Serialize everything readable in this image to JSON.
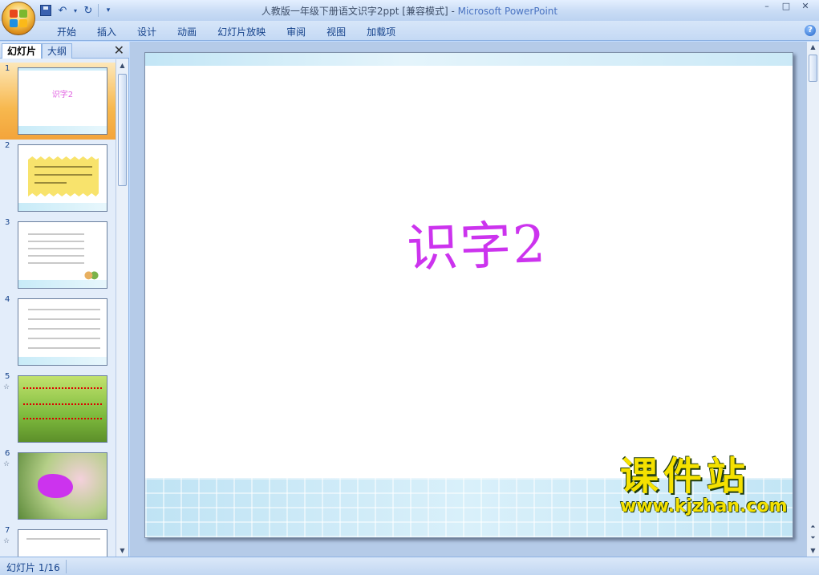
{
  "window": {
    "title_doc": "人教版一年级下册语文识字2ppt [兼容模式]",
    "title_sep": " - ",
    "title_app": "Microsoft PowerPoint",
    "controls": [
      "–",
      "□",
      "✕"
    ]
  },
  "ribbon": {
    "tabs": [
      "开始",
      "插入",
      "设计",
      "动画",
      "幻灯片放映",
      "审阅",
      "视图",
      "加载项"
    ],
    "help": "?"
  },
  "pane": {
    "tab_slides": "幻灯片",
    "tab_outline": "大纲",
    "close": "✕"
  },
  "thumbnails": [
    {
      "num": "1",
      "star": "",
      "title": "识字2"
    },
    {
      "num": "2",
      "star": ""
    },
    {
      "num": "3",
      "star": ""
    },
    {
      "num": "4",
      "star": ""
    },
    {
      "num": "5",
      "star": "☆"
    },
    {
      "num": "6",
      "star": "☆"
    },
    {
      "num": "7",
      "star": "☆"
    }
  ],
  "slide": {
    "title": "识字2"
  },
  "watermark": {
    "cn": "课件站",
    "en": "www.kjzhan.com"
  },
  "status": {
    "slide_counter": "幻灯片 1/16"
  },
  "colors": {
    "accent": "#cc33ee",
    "selection": "#f7b84e",
    "ribbon": "#c4d9f4"
  }
}
